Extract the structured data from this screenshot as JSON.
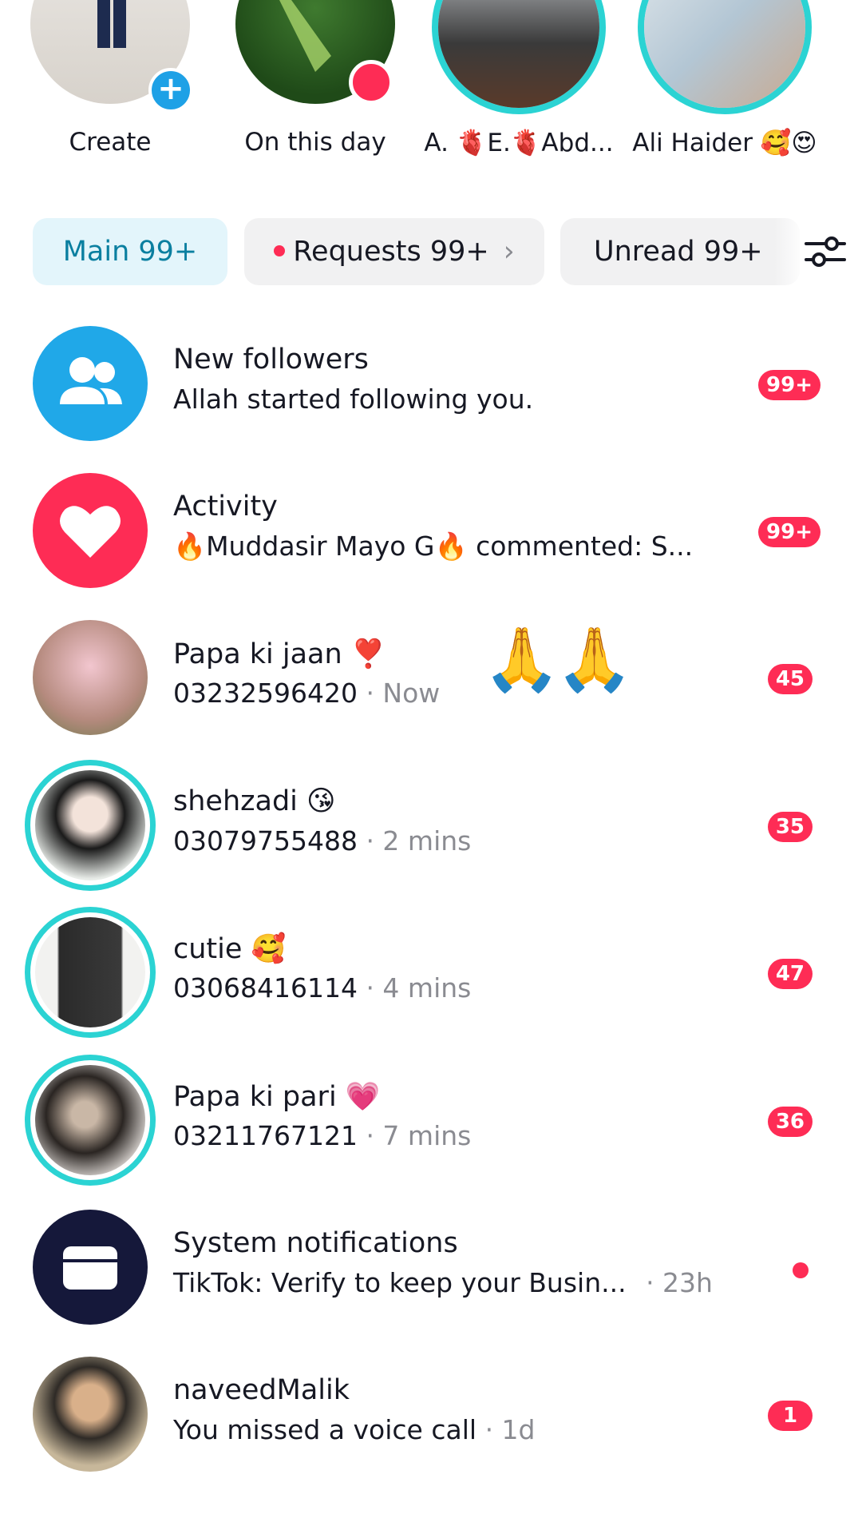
{
  "stories": [
    {
      "name": "Create",
      "badge": "+"
    },
    {
      "name": "On this day"
    },
    {
      "name": "A. 🫀E.🫀Abd..."
    },
    {
      "name": "Ali Haider 🥰😍"
    }
  ],
  "tabs": [
    {
      "label": "Main 99+",
      "active": true
    },
    {
      "label": "Requests 99+",
      "has_dot": true,
      "chevron": "›"
    },
    {
      "label": "Unread 99+"
    }
  ],
  "inbox": [
    {
      "title": "New followers",
      "subtitle": "Allah started following you.",
      "badge": "99+",
      "icon": "people-icon",
      "color": "#20a8e8"
    },
    {
      "title": "Activity",
      "subtitle": "🔥Muddasir Mayo G🔥 commented: S...",
      "badge": "99+",
      "icon": "heart-icon",
      "color": "#fe2c55"
    },
    {
      "title": "Papa ki jaan ❣️",
      "phone": "03232596420",
      "time": "· Now",
      "badge": "45",
      "extra_emoji": "🙏🙏"
    },
    {
      "title": "shehzadi 😘",
      "phone": "03079755488",
      "time": "· 2 mins",
      "badge": "35"
    },
    {
      "title": "cutie 🥰",
      "phone": "03068416114",
      "time": "· 4 mins",
      "badge": "47"
    },
    {
      "title": "Papa ki pari 💗",
      "phone": "03211767121",
      "time": "· 7 mins",
      "badge": "36"
    },
    {
      "title": "System notifications",
      "subtitle": "TikTok: Verify to keep your Busin...",
      "time": "· 23h",
      "icon": "inbox-icon",
      "color": "#15183a"
    },
    {
      "title": "naveedMalik",
      "subtitle": "You missed a voice call",
      "time": "· 1d",
      "badge": "1"
    }
  ]
}
